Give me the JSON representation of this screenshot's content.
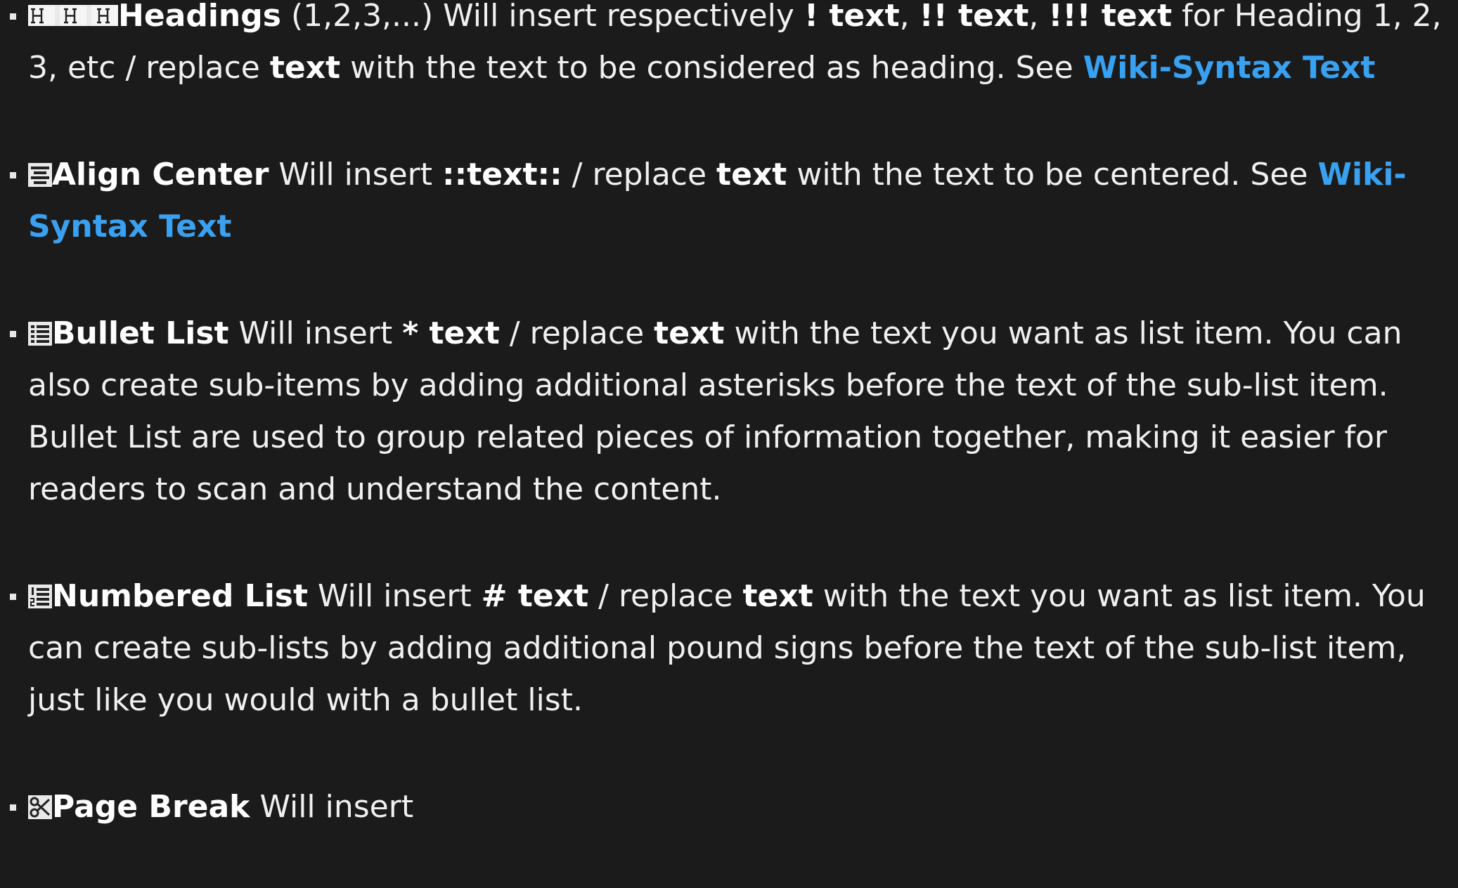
{
  "items": [
    {
      "tool": "Headings",
      "icon": "heading-icons",
      "parts": [
        " (1,2,3,...) Will insert respectively ",
        "! text",
        ", ",
        "!! text",
        ", ",
        "!!! text",
        " for Heading 1, 2, 3, etc / replace ",
        "text",
        " with the text to be considered as heading. See ",
        "Wiki-Syntax Text"
      ]
    },
    {
      "tool": "Align Center",
      "icon": "align-center-icon",
      "parts": [
        " Will insert ",
        "::text::",
        " / replace ",
        "text",
        " with the text to be centered. See ",
        "Wiki-Syntax Text"
      ]
    },
    {
      "tool": "Bullet List",
      "icon": "bullet-list-icon",
      "parts": [
        " Will insert ",
        "* text",
        " / replace ",
        "text",
        " with the text you want as list item. You can also create sub-items by adding additional asterisks before the text of the sub-list item. Bullet List are used to group related pieces of information together, making it easier for readers to scan and understand the content."
      ]
    },
    {
      "tool": "Numbered List",
      "icon": "numbered-list-icon",
      "parts": [
        " Will insert ",
        "# text",
        " / replace ",
        "text",
        " with the text you want as list item. You can create sub-lists by adding additional pound signs before the text of the sub-list item, just like you would with a bullet list."
      ]
    },
    {
      "tool": "Page Break",
      "icon": "scissors-icon",
      "parts": [
        " Will insert"
      ]
    }
  ],
  "colors": {
    "background": "#1b1b1b",
    "text": "#f0f0f0",
    "link": "#3aa0f0"
  }
}
